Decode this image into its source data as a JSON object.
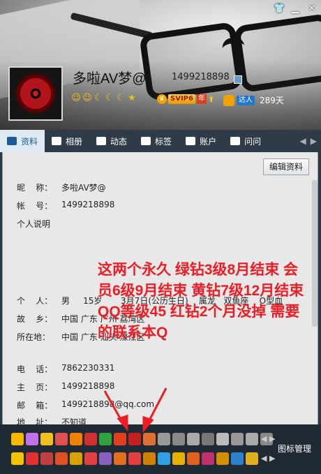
{
  "window": {
    "title_icons": [
      "shirt-icon",
      "minimize-icon",
      "close-icon"
    ]
  },
  "profile": {
    "nickname": "多啦AV梦@",
    "qq": "1499218898",
    "svip_label": "SVIP6",
    "svip_year": "年",
    "daren_label": "达人",
    "days": "289天"
  },
  "tabs": [
    {
      "label": "资料",
      "icon": "profile-card-icon",
      "active": true
    },
    {
      "label": "相册",
      "icon": "photo-icon"
    },
    {
      "label": "动态",
      "icon": "list-icon"
    },
    {
      "label": "标签",
      "icon": "bookmark-icon"
    },
    {
      "label": "账户",
      "icon": "briefcase-icon"
    },
    {
      "label": "问问",
      "icon": "question-icon"
    }
  ],
  "edit_button": "编辑资料",
  "info": {
    "nick_label": "昵    称：",
    "nick_value": "多啦AV梦@",
    "account_label": "帐    号：",
    "account_value": "1499218898",
    "desc_label": "个人说明",
    "person_label": "个    人：",
    "person_value": "男     15岁       3月7日(公历生日)    属龙   双鱼座    O型血",
    "hometown_label": "故    乡：",
    "hometown_value": "中国 广东 广州 荔湾区",
    "location_label": "所在地：",
    "location_value": "中国 广东 汕头 濠江区",
    "phone_label": "电    话：",
    "phone_value": "7862230331",
    "homepage_label": "主    页：",
    "homepage_value": "1499218898",
    "email_label": "邮    箱：",
    "email_value": "1499218898@qq.com",
    "address_label": "地    址：",
    "address_value": "不知道"
  },
  "annotation": "这两个永久 绿钻3级8月结束 会员6级9月结束 黄钻7级12月结束 QQ等级45 红钻2个月没掉 需要的联系本Q",
  "bottom": {
    "icon_manager": "图标管理"
  },
  "colors": {
    "annotation": "#ee1c24",
    "tab_active": "#1c5d99",
    "dark_bar": "#2f3b47"
  }
}
